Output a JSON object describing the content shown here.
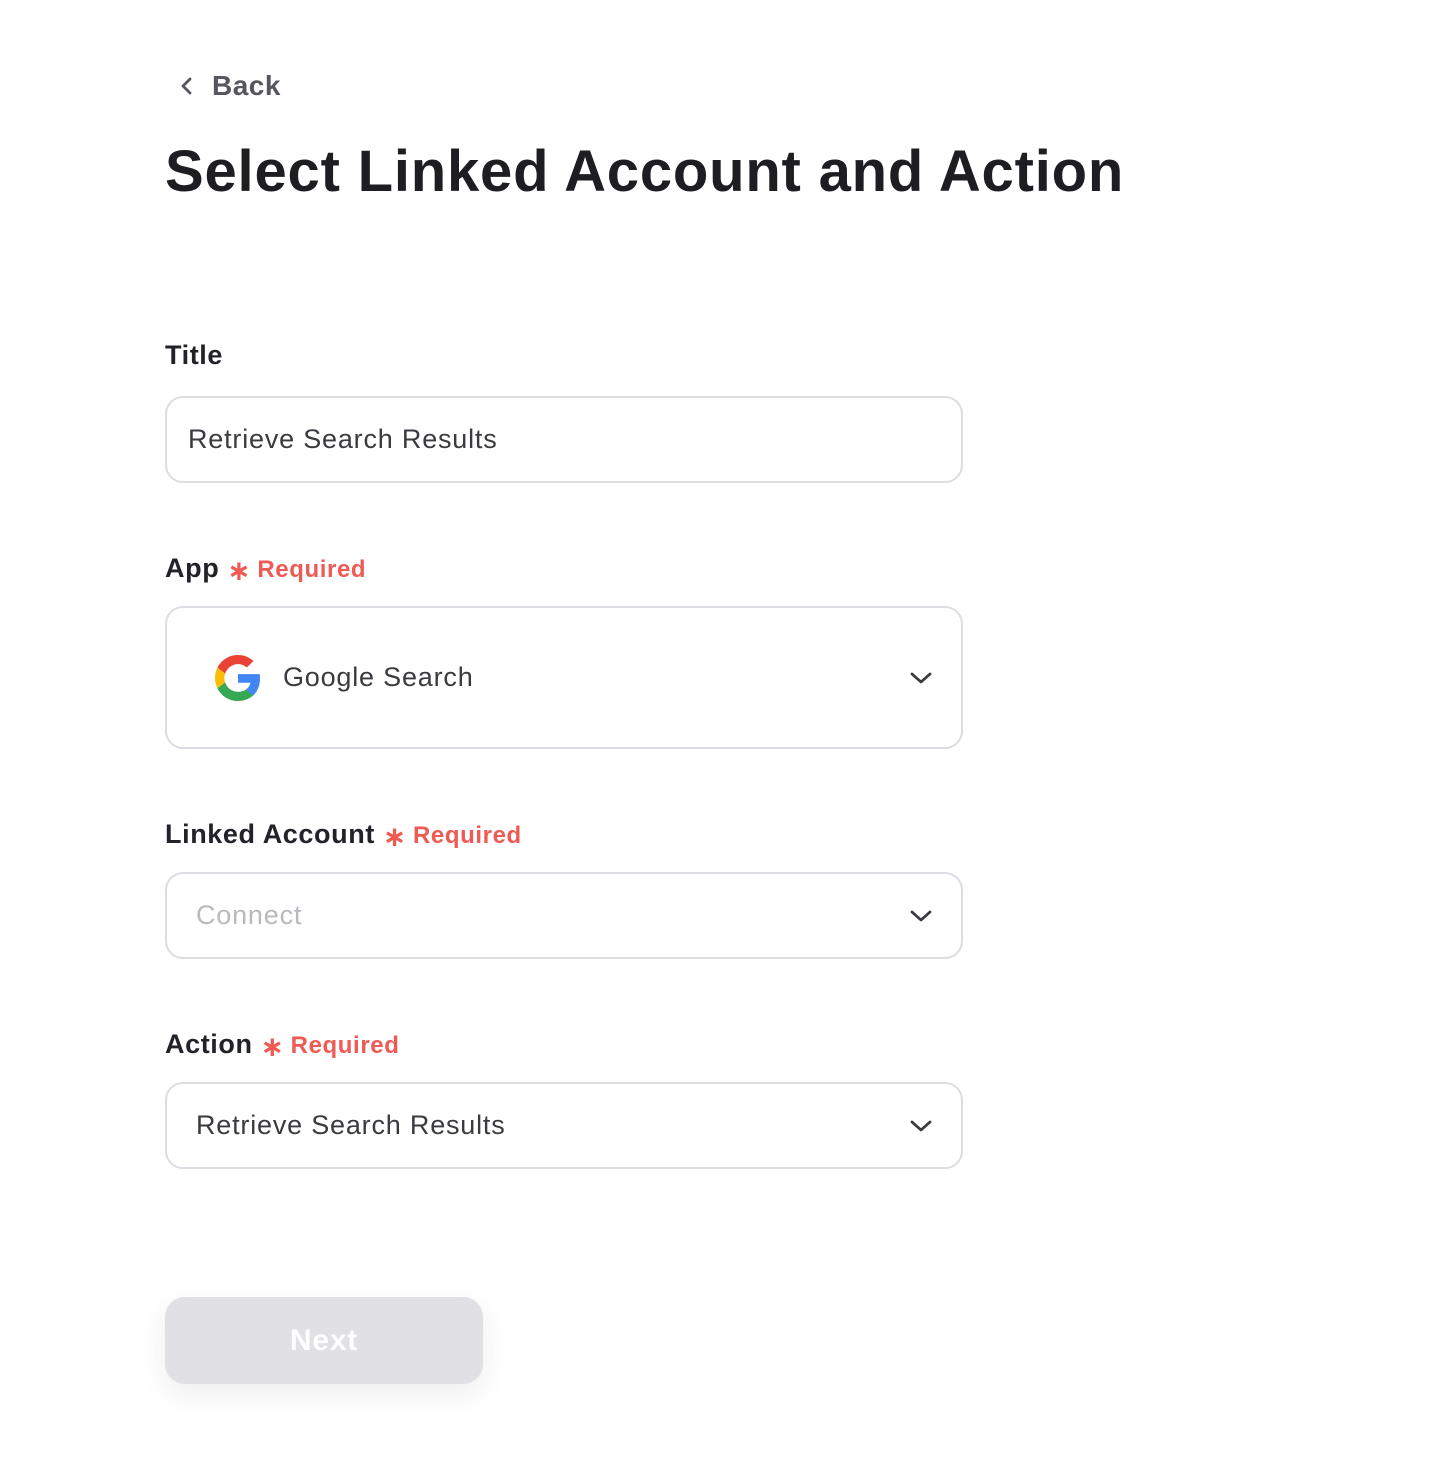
{
  "back": {
    "label": "Back",
    "icon": "chevron-left-icon"
  },
  "page": {
    "title": "Select Linked Account and Action"
  },
  "form": {
    "title_field": {
      "label": "Title",
      "value": "Retrieve Search Results"
    },
    "app_field": {
      "label": "App",
      "required_text": "Required",
      "required_mark": "∗",
      "value": "Google Search",
      "icon": "google-logo-icon"
    },
    "linked_account_field": {
      "label": "Linked Account",
      "required_text": "Required",
      "required_mark": "∗",
      "placeholder": "Connect"
    },
    "action_field": {
      "label": "Action",
      "required_text": "Required",
      "required_mark": "∗",
      "value": "Retrieve Search Results"
    }
  },
  "next_button": {
    "label": "Next"
  },
  "colors": {
    "required": "#ef5a55",
    "field_border": "#dcdce3",
    "button_disabled_bg": "#e1e0e5"
  }
}
